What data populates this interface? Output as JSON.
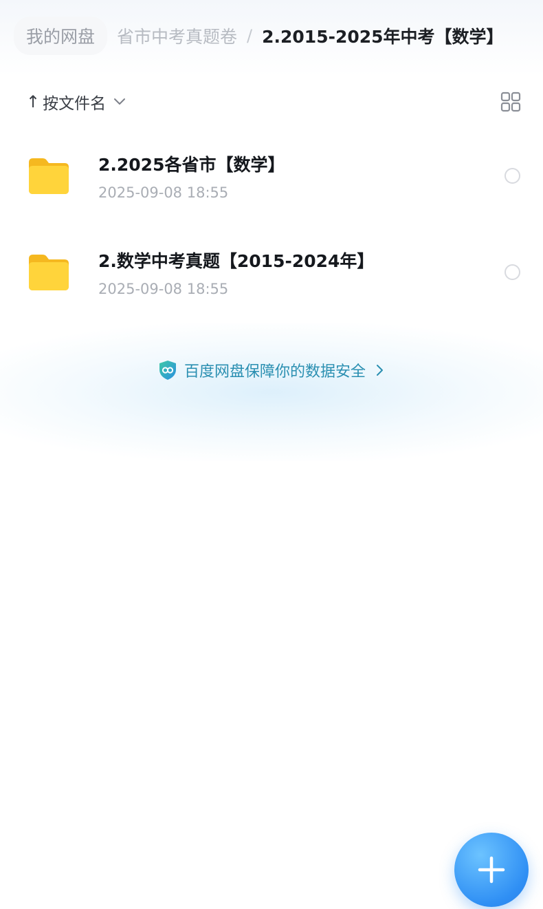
{
  "breadcrumb": {
    "root": "我的网盘",
    "middle": "省市中考真题卷",
    "separator": "/",
    "current": "2.2015-2025年中考【数学】"
  },
  "toolbar": {
    "sort_label": "按文件名",
    "sort_arrow": "↑",
    "sort_chevron_icon": "chevron-down-icon",
    "view_toggle_icon": "grid-view-icon"
  },
  "files": [
    {
      "name": "2.2025各省市【数学】",
      "date": "2025-09-08 18:55",
      "icon": "folder-icon"
    },
    {
      "name": "2.数学中考真题【2015-2024年】",
      "date": "2025-09-08 18:55",
      "icon": "folder-icon"
    }
  ],
  "security_note": {
    "text": "百度网盘保障你的数据安全",
    "icon": "shield-icon",
    "color": "#2a8fb1"
  },
  "fab": {
    "icon": "plus-icon",
    "color": "#2f8ff4"
  },
  "colors": {
    "folder": "#ffcc2e",
    "accent": "#2f8ff4"
  }
}
